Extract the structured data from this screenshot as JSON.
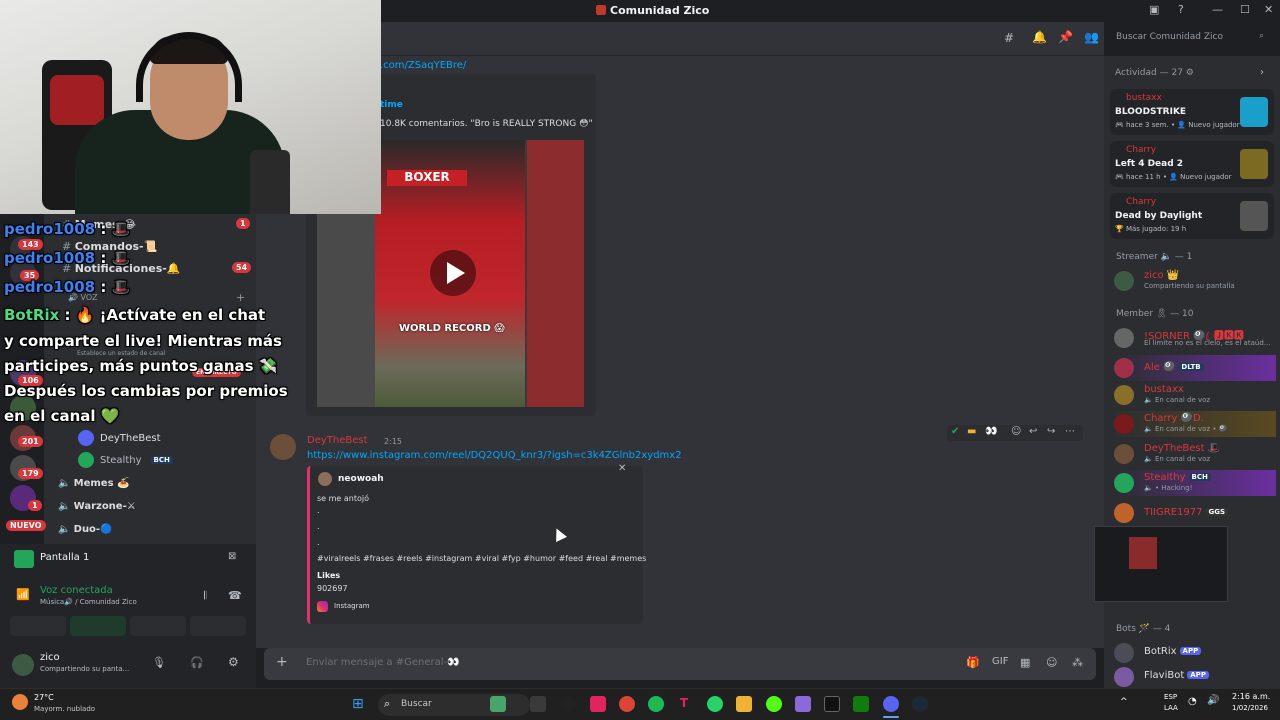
{
  "window": {
    "title": "Comunidad Zico",
    "controls": [
      "—",
      "☐",
      "✕"
    ]
  },
  "header": {
    "search_placeholder": "Buscar Comunidad Zico"
  },
  "chat": {
    "link_fragment": ".com/ZSaqYEBre/",
    "embed1": {
      "provider_fragment": "time",
      "description": "10.8K comentarios. \"Bro is REALLY STRONG 😳\"",
      "video_caption": "WORLD RECORD 😱",
      "sign_text": "BOXER"
    },
    "message2": {
      "author": "DeyTheBest",
      "time": "2:15",
      "link": "https://www.instagram.com/reel/DQ2QUQ_knr3/?igsh=c3k4ZGlnb2xydmx2",
      "embed": {
        "author": "neowoah",
        "line1": "se me antojó",
        "dots": [
          ".",
          ".",
          "."
        ],
        "hashtags": "#viralreels #frases #reels #instagram #viral #fyp #humor #feed #real #memes",
        "likes_label": "Likes",
        "likes_value": "902697",
        "footer": "Instagram"
      }
    },
    "composer_placeholder": "Enviar mensaje a #General-👀"
  },
  "sidebar": {
    "channels": [
      {
        "name": "Memes-😂",
        "badge": "1"
      },
      {
        "name": "Comandos-📜"
      },
      {
        "name": "Notificaciones-🔔",
        "badge": "54"
      }
    ],
    "voice_category": "VOZ",
    "guild_badges": [
      "143",
      "35",
      "106",
      "201",
      "179",
      "1"
    ],
    "new_badge": "NUEVO",
    "live_badge": "EN DIRECTO",
    "status_hint": "Establece un estado de canal",
    "voice_users": [
      {
        "name": "DeyTheBest"
      },
      {
        "name": "Stealthy",
        "tag": "BCH"
      }
    ],
    "voice_channels": [
      "Memes 🍝",
      "Warzone-⚔",
      "Duo-🔵"
    ],
    "screen_share": "Pantalla 1",
    "voice_status": "Voz conectada",
    "voice_location": "Música🔊 / Comunidad Zico",
    "user": {
      "name": "zico",
      "status": "Compartiendo su panta..."
    }
  },
  "overlay_chat": [
    {
      "user": "pedro1008",
      "text": "🎩"
    },
    {
      "user": "pedro1008",
      "text": "🎩"
    },
    {
      "user": "pedro1008",
      "text": "🎩"
    },
    {
      "user": "BotRix",
      "text": "🔥 ¡Actívate en el chat"
    },
    {
      "line": "y comparte el live! Mientras más"
    },
    {
      "line": "participes, más puntos ganas 💸"
    },
    {
      "line": "Después los cambias por premios"
    },
    {
      "line": "en el canal 💚"
    }
  ],
  "members": {
    "activity_header": "Actividad — 27 ⚙",
    "activities": [
      {
        "user": "bustaxx",
        "game": "BLOODSTRIKE",
        "meta": "🎮 hace 3 sem. • 👤 Nuevo jugador",
        "color": "#1aa0c8"
      },
      {
        "user": "Charry",
        "game": "Left 4 Dead 2",
        "meta": "🎮 hace 11 h • 👤 Nuevo jugador",
        "color": "#7a6a22"
      },
      {
        "user": "Charry",
        "game": "Dead by Daylight",
        "meta": "🏆 Más jugado: 19 h",
        "color": "#555"
      }
    ],
    "streamer_header": "Streamer 🔈 — 1",
    "streamer": {
      "name": "zico 👑",
      "status": "Compartiendo su pantalla"
    },
    "member_header": "Member 🎗 — 10",
    "list": [
      {
        "name": "!SORNER 🎱ꦿ🅹🅺🅺",
        "status": "El limite no es el cielo, es el ataúd...",
        "color": "#da373c"
      },
      {
        "name": "Ale 🎱",
        "tag": "DLTB",
        "status": "",
        "color": "#da373c"
      },
      {
        "name": "bustaxx",
        "status": "🔈 En canal de voz",
        "color": "#da373c"
      },
      {
        "name": "Charry 🎱D.",
        "status": "🔈 En canal de voz • 🎱",
        "color": "#da373c"
      },
      {
        "name": "DeyTheBest 🎩",
        "status": "🔈 En canal de voz",
        "color": "#da373c"
      },
      {
        "name": "Stealthy",
        "tag": "BCH",
        "status": "🔈 • Hacking!",
        "color": "#da373c"
      },
      {
        "name": "TIIGRE1977",
        "tag": "GGS",
        "status": "",
        "color": "#da373c"
      }
    ],
    "bots_header": "Bots 🪄 — 4",
    "bots": [
      {
        "name": "BotRix",
        "tag": "APP"
      },
      {
        "name": "FlaviBot",
        "tag": "APP"
      }
    ]
  },
  "taskbar": {
    "weather_temp": "27°C",
    "weather_desc": "Mayorm. nublado",
    "search": "Buscar",
    "lang1": "ESP",
    "lang2": "LAA",
    "time": "2:16 a.m.",
    "date": "1/02/2026"
  }
}
